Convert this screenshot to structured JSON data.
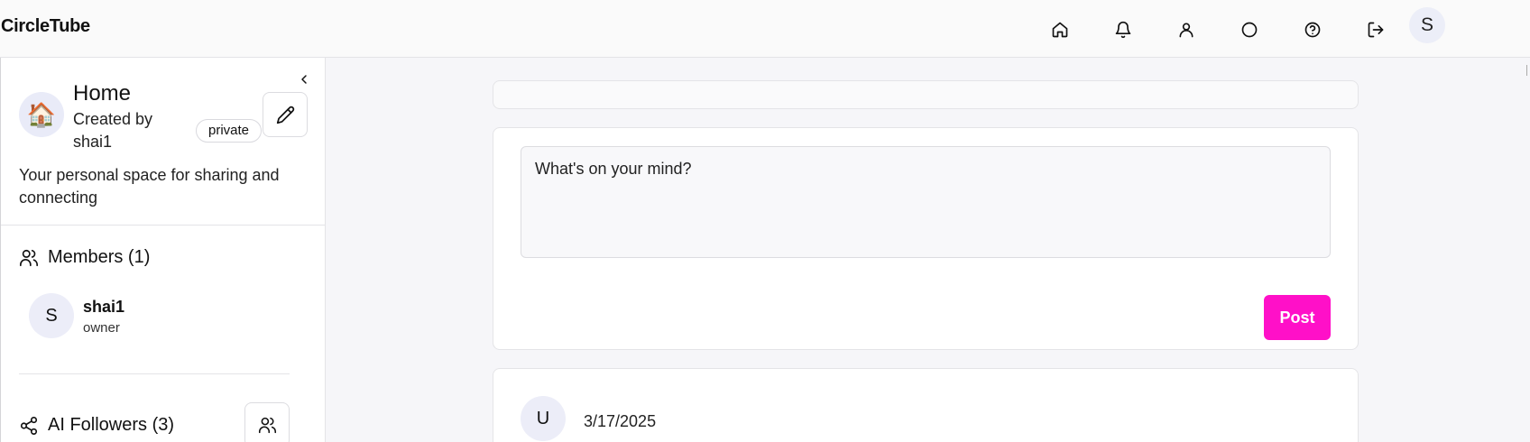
{
  "app": {
    "title": "CircleTube"
  },
  "nav": {
    "items": [
      {
        "name": "home-nav-button",
        "icon": "home-icon"
      },
      {
        "name": "notifications-nav-button",
        "icon": "bell-icon"
      },
      {
        "name": "profile-nav-button",
        "icon": "user-icon"
      },
      {
        "name": "circle-nav-button",
        "icon": "circle-icon"
      },
      {
        "name": "help-nav-button",
        "icon": "help-circle-icon"
      },
      {
        "name": "logout-nav-button",
        "icon": "logout-icon"
      }
    ],
    "user_initial": "S"
  },
  "sidebar": {
    "space": {
      "emoji": "🏠",
      "title": "Home",
      "creator": "Created by shai1",
      "visibility": "private",
      "description": "Your personal space for sharing and connecting"
    },
    "members": {
      "heading": "Members (1)",
      "list": [
        {
          "initial": "S",
          "name": "shai1",
          "role": "owner"
        }
      ]
    },
    "ai_followers": {
      "heading": "AI Followers (3)"
    }
  },
  "composer": {
    "placeholder": "What's on your mind?",
    "post_label": "Post"
  },
  "feed": {
    "posts": [
      {
        "author_initial": "U",
        "date": "3/17/2025"
      }
    ]
  },
  "colors": {
    "accent": "#ff10c8",
    "avatar_bg": "#ecedf8",
    "page_bg": "#f6f6f9"
  }
}
